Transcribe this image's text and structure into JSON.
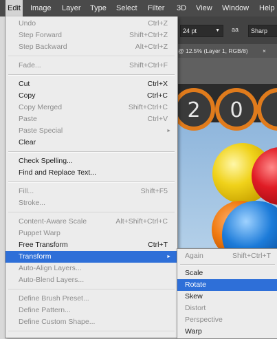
{
  "menubar": {
    "items": [
      "Edit",
      "Image",
      "Layer",
      "Type",
      "Select",
      "Filter",
      "3D",
      "View",
      "Window",
      "Help"
    ],
    "active": "Edit"
  },
  "options_bar": {
    "font_size": "24 pt",
    "antialias_icon": "aa",
    "antialias_value": "Sharp"
  },
  "document_tab": {
    "title": "@ 12.5% (Layer 1, RGB/8)",
    "close": "×"
  },
  "canvas": {
    "digits": [
      "2",
      "0"
    ]
  },
  "edit_menu": {
    "items": [
      {
        "label": "Undo",
        "shortcut": "Ctrl+Z",
        "disabled": true
      },
      {
        "label": "Step Forward",
        "shortcut": "Shift+Ctrl+Z",
        "disabled": true
      },
      {
        "label": "Step Backward",
        "shortcut": "Alt+Ctrl+Z",
        "disabled": true
      },
      {
        "label": "Fade...",
        "shortcut": "Shift+Ctrl+F",
        "disabled": true
      },
      {
        "label": "Cut",
        "shortcut": "Ctrl+X",
        "disabled": false
      },
      {
        "label": "Copy",
        "shortcut": "Ctrl+C",
        "disabled": false
      },
      {
        "label": "Copy Merged",
        "shortcut": "Shift+Ctrl+C",
        "disabled": true
      },
      {
        "label": "Paste",
        "shortcut": "Ctrl+V",
        "disabled": true
      },
      {
        "label": "Paste Special",
        "shortcut": "",
        "disabled": true,
        "submenu": true
      },
      {
        "label": "Clear",
        "shortcut": "",
        "disabled": false
      },
      {
        "label": "Check Spelling...",
        "shortcut": "",
        "disabled": false
      },
      {
        "label": "Find and Replace Text...",
        "shortcut": "",
        "disabled": false
      },
      {
        "label": "Fill...",
        "shortcut": "Shift+F5",
        "disabled": true
      },
      {
        "label": "Stroke...",
        "shortcut": "",
        "disabled": true
      },
      {
        "label": "Content-Aware Scale",
        "shortcut": "Alt+Shift+Ctrl+C",
        "disabled": true
      },
      {
        "label": "Puppet Warp",
        "shortcut": "",
        "disabled": true
      },
      {
        "label": "Free Transform",
        "shortcut": "Ctrl+T",
        "disabled": false
      },
      {
        "label": "Transform",
        "shortcut": "",
        "disabled": false,
        "submenu": true,
        "highlighted": true
      },
      {
        "label": "Auto-Align Layers...",
        "shortcut": "",
        "disabled": true
      },
      {
        "label": "Auto-Blend Layers...",
        "shortcut": "",
        "disabled": true
      },
      {
        "label": "Define Brush Preset...",
        "shortcut": "",
        "disabled": true
      },
      {
        "label": "Define Pattern...",
        "shortcut": "",
        "disabled": true
      },
      {
        "label": "Define Custom Shape...",
        "shortcut": "",
        "disabled": true
      }
    ]
  },
  "transform_submenu": {
    "items": [
      {
        "label": "Again",
        "shortcut": "Shift+Ctrl+T",
        "disabled": true
      },
      {
        "label": "Scale",
        "shortcut": "",
        "disabled": false
      },
      {
        "label": "Rotate",
        "shortcut": "",
        "disabled": false,
        "highlighted": true
      },
      {
        "label": "Skew",
        "shortcut": "",
        "disabled": false
      },
      {
        "label": "Distort",
        "shortcut": "",
        "disabled": true
      },
      {
        "label": "Perspective",
        "shortcut": "",
        "disabled": true
      },
      {
        "label": "Warp",
        "shortcut": "",
        "disabled": false
      }
    ]
  },
  "colors": {
    "menu_bg": "#ececec",
    "highlight": "#2e6fd8",
    "menubar_bg": "#4a4a4a",
    "disabled_text": "#8c8c8c"
  }
}
